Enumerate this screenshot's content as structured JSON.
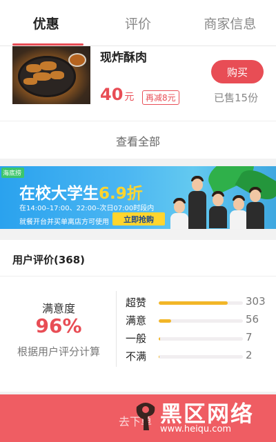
{
  "tabs": [
    {
      "label": "优惠",
      "active": true
    },
    {
      "label": "评价",
      "active": false
    },
    {
      "label": "商家信息",
      "active": false
    }
  ],
  "deal": {
    "name": "现炸酥肉",
    "price": "40",
    "price_unit": "元",
    "discount": "再减8元",
    "buy_label": "购买",
    "sold": "已售15份",
    "view_all": "查看全部"
  },
  "banner": {
    "logo": "海底捞",
    "title_prefix": "在校大学生",
    "title_highlight": "6.9折",
    "time_line": "在14:00–17:00、22:00–次日07:00时段内",
    "note_line": "就餐开台并买单离店方可使用",
    "cta": "立即抢购"
  },
  "reviews": {
    "title": "用户评价(368)",
    "satisfaction_label": "满意度",
    "satisfaction_value": "96%",
    "satisfaction_sub": "根据用户评分计算",
    "ratings": [
      {
        "label": "超赞",
        "count": "303",
        "fraction": 0.82
      },
      {
        "label": "满意",
        "count": "56",
        "fraction": 0.15
      },
      {
        "label": "一般",
        "count": "7",
        "fraction": 0.02
      },
      {
        "label": "不满",
        "count": "2",
        "fraction": 0.01
      }
    ]
  },
  "bottom": {
    "button": "去下单"
  },
  "watermark": {
    "text": "黑区网络",
    "url": "www.heiqu.com"
  },
  "colors": {
    "accent": "#e84d55",
    "bar": "#f2b628",
    "bottom_bar": "#ef5d63"
  }
}
